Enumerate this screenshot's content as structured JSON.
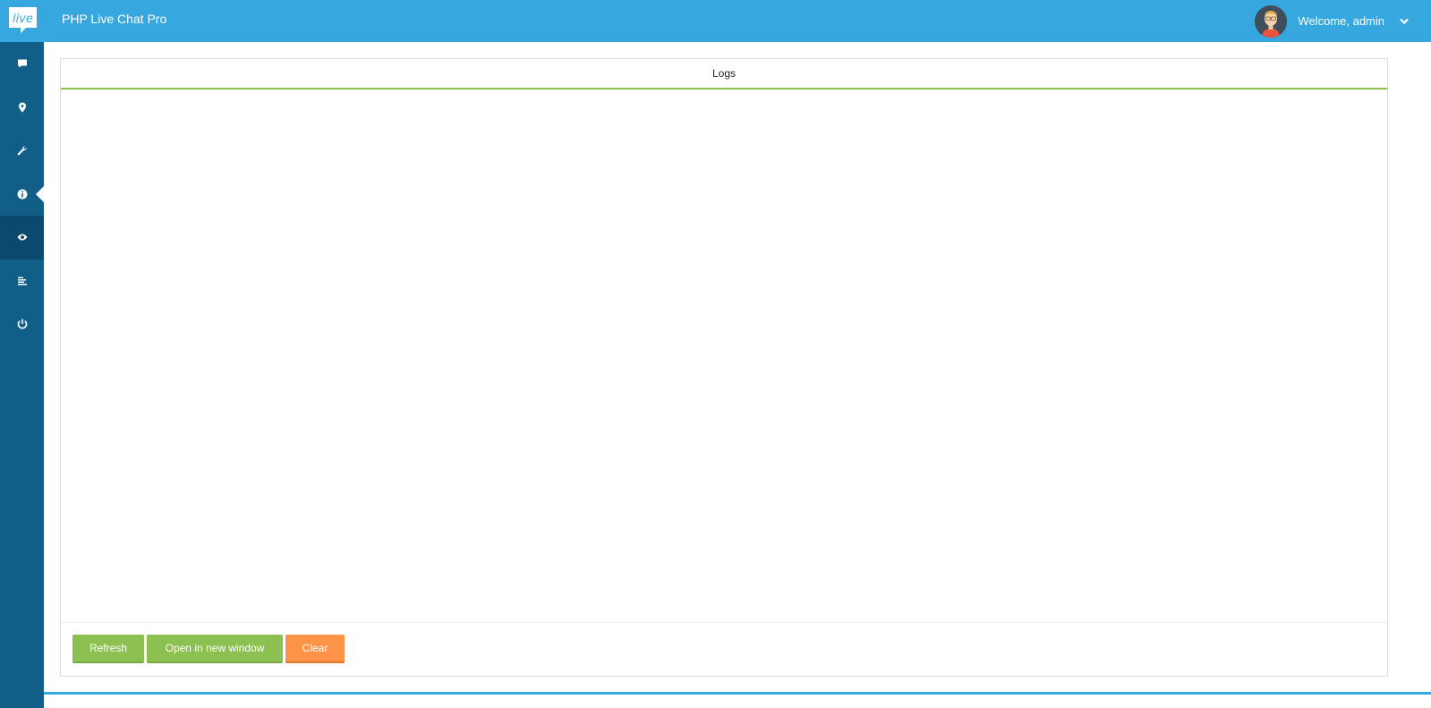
{
  "header": {
    "logo_text": "live",
    "app_title": "PHP Live Chat Pro",
    "welcome_text": "Welcome, admin"
  },
  "sidebar": {
    "items": [
      {
        "icon": "chat-bubble-icon",
        "active": false
      },
      {
        "icon": "map-marker-icon",
        "active": false
      },
      {
        "icon": "wrench-icon",
        "active": false
      },
      {
        "icon": "info-icon",
        "active": false,
        "pointer": true
      },
      {
        "icon": "eye-icon",
        "active": true
      },
      {
        "icon": "align-left-icon",
        "active": false
      },
      {
        "icon": "power-icon",
        "active": false
      }
    ]
  },
  "panel": {
    "title": "Logs",
    "log_content": ""
  },
  "footer": {
    "refresh_label": "Refresh",
    "open_new_window_label": "Open in new window",
    "clear_label": "Clear"
  },
  "colors": {
    "topbar": "#36a8df",
    "sidebar": "#115f89",
    "sidebar_active": "#0b4a6e",
    "accent_green": "#8cc152",
    "accent_orange": "#fc9347"
  }
}
